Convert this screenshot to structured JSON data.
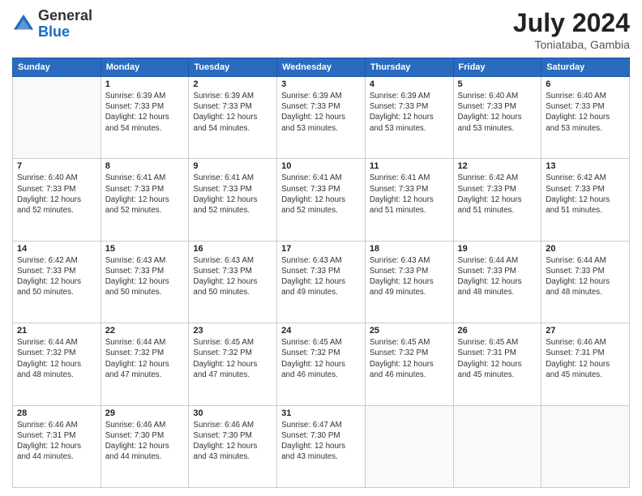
{
  "logo": {
    "general": "General",
    "blue": "Blue"
  },
  "title": {
    "month_year": "July 2024",
    "location": "Toniataba, Gambia"
  },
  "days_of_week": [
    "Sunday",
    "Monday",
    "Tuesday",
    "Wednesday",
    "Thursday",
    "Friday",
    "Saturday"
  ],
  "weeks": [
    [
      {
        "day": "",
        "info": ""
      },
      {
        "day": "1",
        "info": "Sunrise: 6:39 AM\nSunset: 7:33 PM\nDaylight: 12 hours\nand 54 minutes."
      },
      {
        "day": "2",
        "info": "Sunrise: 6:39 AM\nSunset: 7:33 PM\nDaylight: 12 hours\nand 54 minutes."
      },
      {
        "day": "3",
        "info": "Sunrise: 6:39 AM\nSunset: 7:33 PM\nDaylight: 12 hours\nand 53 minutes."
      },
      {
        "day": "4",
        "info": "Sunrise: 6:39 AM\nSunset: 7:33 PM\nDaylight: 12 hours\nand 53 minutes."
      },
      {
        "day": "5",
        "info": "Sunrise: 6:40 AM\nSunset: 7:33 PM\nDaylight: 12 hours\nand 53 minutes."
      },
      {
        "day": "6",
        "info": "Sunrise: 6:40 AM\nSunset: 7:33 PM\nDaylight: 12 hours\nand 53 minutes."
      }
    ],
    [
      {
        "day": "7",
        "info": "Sunrise: 6:40 AM\nSunset: 7:33 PM\nDaylight: 12 hours\nand 52 minutes."
      },
      {
        "day": "8",
        "info": "Sunrise: 6:41 AM\nSunset: 7:33 PM\nDaylight: 12 hours\nand 52 minutes."
      },
      {
        "day": "9",
        "info": "Sunrise: 6:41 AM\nSunset: 7:33 PM\nDaylight: 12 hours\nand 52 minutes."
      },
      {
        "day": "10",
        "info": "Sunrise: 6:41 AM\nSunset: 7:33 PM\nDaylight: 12 hours\nand 52 minutes."
      },
      {
        "day": "11",
        "info": "Sunrise: 6:41 AM\nSunset: 7:33 PM\nDaylight: 12 hours\nand 51 minutes."
      },
      {
        "day": "12",
        "info": "Sunrise: 6:42 AM\nSunset: 7:33 PM\nDaylight: 12 hours\nand 51 minutes."
      },
      {
        "day": "13",
        "info": "Sunrise: 6:42 AM\nSunset: 7:33 PM\nDaylight: 12 hours\nand 51 minutes."
      }
    ],
    [
      {
        "day": "14",
        "info": "Sunrise: 6:42 AM\nSunset: 7:33 PM\nDaylight: 12 hours\nand 50 minutes."
      },
      {
        "day": "15",
        "info": "Sunrise: 6:43 AM\nSunset: 7:33 PM\nDaylight: 12 hours\nand 50 minutes."
      },
      {
        "day": "16",
        "info": "Sunrise: 6:43 AM\nSunset: 7:33 PM\nDaylight: 12 hours\nand 50 minutes."
      },
      {
        "day": "17",
        "info": "Sunrise: 6:43 AM\nSunset: 7:33 PM\nDaylight: 12 hours\nand 49 minutes."
      },
      {
        "day": "18",
        "info": "Sunrise: 6:43 AM\nSunset: 7:33 PM\nDaylight: 12 hours\nand 49 minutes."
      },
      {
        "day": "19",
        "info": "Sunrise: 6:44 AM\nSunset: 7:33 PM\nDaylight: 12 hours\nand 48 minutes."
      },
      {
        "day": "20",
        "info": "Sunrise: 6:44 AM\nSunset: 7:33 PM\nDaylight: 12 hours\nand 48 minutes."
      }
    ],
    [
      {
        "day": "21",
        "info": "Sunrise: 6:44 AM\nSunset: 7:32 PM\nDaylight: 12 hours\nand 48 minutes."
      },
      {
        "day": "22",
        "info": "Sunrise: 6:44 AM\nSunset: 7:32 PM\nDaylight: 12 hours\nand 47 minutes."
      },
      {
        "day": "23",
        "info": "Sunrise: 6:45 AM\nSunset: 7:32 PM\nDaylight: 12 hours\nand 47 minutes."
      },
      {
        "day": "24",
        "info": "Sunrise: 6:45 AM\nSunset: 7:32 PM\nDaylight: 12 hours\nand 46 minutes."
      },
      {
        "day": "25",
        "info": "Sunrise: 6:45 AM\nSunset: 7:32 PM\nDaylight: 12 hours\nand 46 minutes."
      },
      {
        "day": "26",
        "info": "Sunrise: 6:45 AM\nSunset: 7:31 PM\nDaylight: 12 hours\nand 45 minutes."
      },
      {
        "day": "27",
        "info": "Sunrise: 6:46 AM\nSunset: 7:31 PM\nDaylight: 12 hours\nand 45 minutes."
      }
    ],
    [
      {
        "day": "28",
        "info": "Sunrise: 6:46 AM\nSunset: 7:31 PM\nDaylight: 12 hours\nand 44 minutes."
      },
      {
        "day": "29",
        "info": "Sunrise: 6:46 AM\nSunset: 7:30 PM\nDaylight: 12 hours\nand 44 minutes."
      },
      {
        "day": "30",
        "info": "Sunrise: 6:46 AM\nSunset: 7:30 PM\nDaylight: 12 hours\nand 43 minutes."
      },
      {
        "day": "31",
        "info": "Sunrise: 6:47 AM\nSunset: 7:30 PM\nDaylight: 12 hours\nand 43 minutes."
      },
      {
        "day": "",
        "info": ""
      },
      {
        "day": "",
        "info": ""
      },
      {
        "day": "",
        "info": ""
      }
    ]
  ]
}
